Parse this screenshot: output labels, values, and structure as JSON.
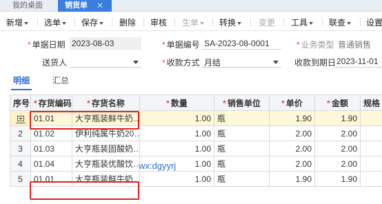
{
  "tabs": {
    "home": "我的桌面",
    "active": "销货单",
    "close": "✕"
  },
  "toolbar": {
    "items": [
      {
        "label": "新增",
        "dropdown": true,
        "disabled": false
      },
      {
        "label": "选单",
        "dropdown": true,
        "disabled": false
      },
      {
        "label": "保存",
        "dropdown": true,
        "disabled": false
      },
      {
        "label": "删除",
        "dropdown": false,
        "disabled": false
      },
      {
        "label": "审核",
        "dropdown": false,
        "disabled": false
      },
      {
        "label": "生单",
        "dropdown": true,
        "disabled": true
      },
      {
        "label": "转换",
        "dropdown": true,
        "disabled": false
      },
      {
        "label": "变更",
        "dropdown": false,
        "disabled": true
      },
      {
        "label": "工具",
        "dropdown": true,
        "disabled": false
      },
      {
        "label": "联查",
        "dropdown": true,
        "disabled": false
      },
      {
        "label": "设置",
        "dropdown": false,
        "disabled": false
      }
    ]
  },
  "form": {
    "doc_date_label": "单据日期",
    "doc_date_value": "2023-08-03",
    "doc_no_label": "单据编号",
    "doc_no_value": "SA-2023-08-0001",
    "biz_type_label": "业务类型",
    "biz_type_value": "普通销售",
    "deliverer_label": "送货人",
    "payment_label": "收款方式",
    "payment_value": "月结",
    "due_date_label": "收款到期日",
    "due_date_value": "2023-11-01"
  },
  "subtabs": {
    "detail": "明细",
    "summary": "汇总"
  },
  "grid": {
    "headers": {
      "seq": "序号",
      "code": "存货编码",
      "name": "存货名称",
      "qty": "数量",
      "unit": "销售单位",
      "price": "单价",
      "amount": "金额",
      "spec": "规格"
    },
    "rows": [
      {
        "seq": "",
        "code": "01.01",
        "name": "大亨瓶装鲜牛奶…",
        "qty": "1.00",
        "unit": "瓶",
        "price": "1.90",
        "amount": "1.90"
      },
      {
        "seq": "2",
        "code": "01.02",
        "name": "伊利纯属牛奶20…",
        "qty": "1.00",
        "unit": "瓶",
        "price": "2.00",
        "amount": "2.00"
      },
      {
        "seq": "3",
        "code": "01.03",
        "name": "大亨瓶装固酸奶…",
        "qty": "1.00",
        "unit": "瓶",
        "price": "2.00",
        "amount": "2.00"
      },
      {
        "seq": "4",
        "code": "01.04",
        "name": "大亨瓶装优酸饮…",
        "qty": "1.00",
        "unit": "瓶",
        "price": "2.00",
        "amount": "2.00"
      },
      {
        "seq": "5",
        "code": "01.01",
        "name": "大亨瓶装鲜牛奶…",
        "qty": "1.00",
        "unit": "瓶",
        "price": "1.90",
        "amount": "1.90"
      }
    ]
  },
  "watermark": "wx:dgyyrj",
  "colors": {
    "accent": "#3a7ee0",
    "required": "#e34b4b",
    "highlight": "#e0201b",
    "selected_row": "#fdf8d8"
  }
}
